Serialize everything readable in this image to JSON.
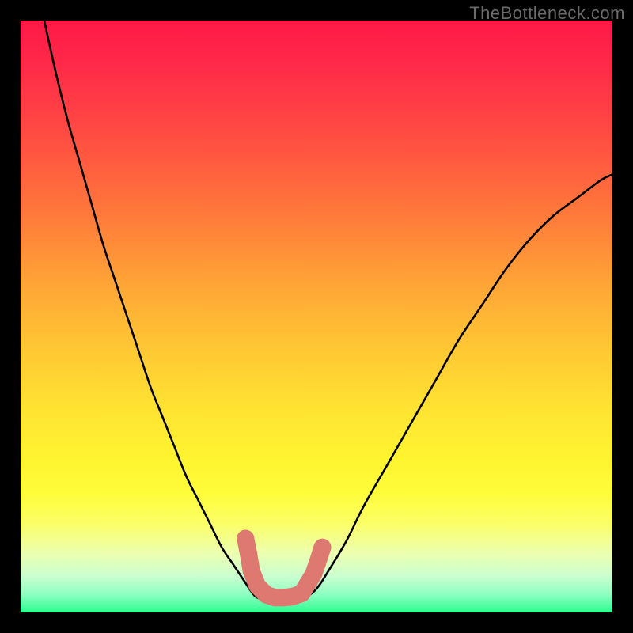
{
  "watermark": "TheBottleneck.com",
  "chart_data": {
    "type": "line",
    "title": "",
    "xlabel": "",
    "ylabel": "",
    "xlim": [
      0,
      100
    ],
    "ylim": [
      0,
      100
    ],
    "series": [
      {
        "name": "left-curve",
        "x": [
          4,
          6,
          8,
          10,
          12,
          14,
          16,
          18,
          20,
          22,
          24,
          26,
          28,
          30,
          32,
          34,
          36,
          38,
          39,
          40
        ],
        "y": [
          100,
          91,
          83,
          76,
          69,
          62,
          56,
          50,
          44,
          38,
          33,
          28,
          23,
          19,
          15,
          11,
          8,
          5,
          3.5,
          2.5
        ]
      },
      {
        "name": "valley-floor",
        "x": [
          40,
          42,
          44,
          46,
          48
        ],
        "y": [
          2.5,
          2.0,
          2.0,
          2.0,
          2.5
        ]
      },
      {
        "name": "right-curve",
        "x": [
          48,
          50,
          52,
          55,
          58,
          62,
          66,
          70,
          74,
          78,
          82,
          86,
          90,
          94,
          98,
          100
        ],
        "y": [
          2.5,
          4,
          7,
          12,
          18,
          25,
          32,
          39,
          46,
          52,
          58,
          63,
          67,
          70,
          73,
          74
        ]
      }
    ],
    "markers": {
      "name": "highlight-markers",
      "color": "#dd7971",
      "points": [
        {
          "x": 38.0,
          "y": 12.5
        },
        {
          "x": 38.5,
          "y": 10.0
        },
        {
          "x": 39.0,
          "y": 7.0
        },
        {
          "x": 40.0,
          "y": 4.5
        },
        {
          "x": 41.5,
          "y": 3.0
        },
        {
          "x": 43.0,
          "y": 2.5
        },
        {
          "x": 44.5,
          "y": 2.5
        },
        {
          "x": 46.0,
          "y": 2.7
        },
        {
          "x": 47.5,
          "y": 3.2
        },
        {
          "x": 49.5,
          "y": 6.5
        },
        {
          "x": 50.2,
          "y": 8.5
        },
        {
          "x": 51.0,
          "y": 11.0
        }
      ]
    }
  }
}
